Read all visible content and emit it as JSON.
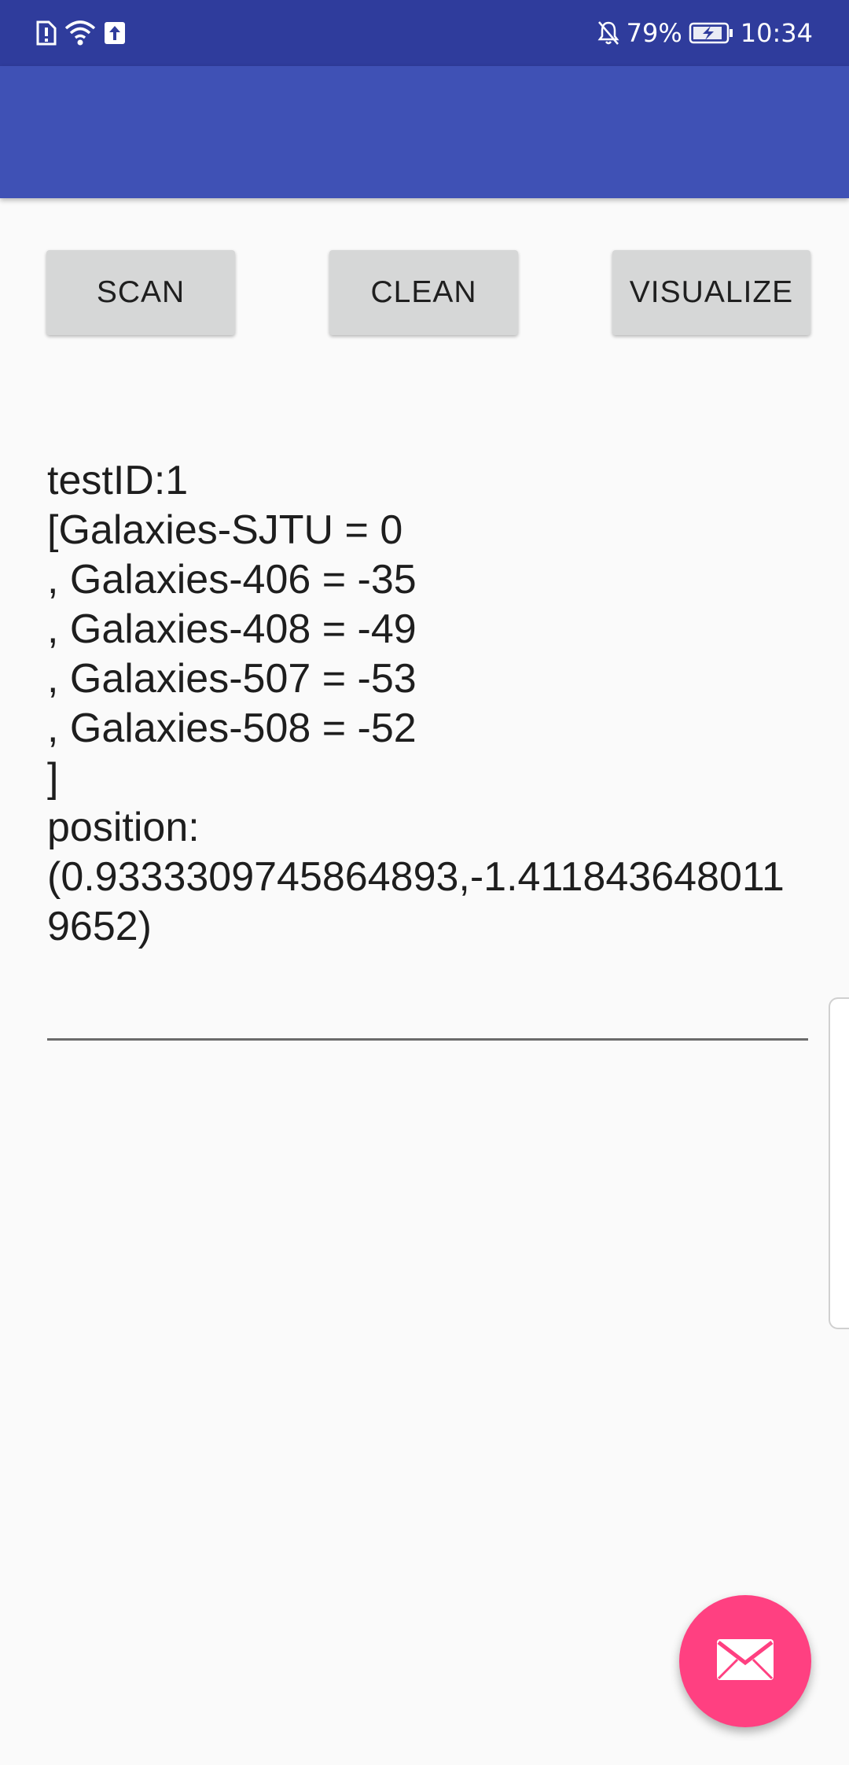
{
  "status_bar": {
    "battery_percent": "79%",
    "time": "10:34",
    "background": "#2f3c9c",
    "left_icons": [
      "sim-alert-icon",
      "wifi-icon",
      "upload-icon"
    ],
    "right_icons": [
      "notifications-off-icon",
      "battery-charging-icon"
    ]
  },
  "app_bar": {
    "background": "#3f51b5"
  },
  "buttons": {
    "scan": "SCAN",
    "clean": "CLEAN",
    "visualize": "VISUALIZE"
  },
  "result_text": "testID:1\n[Galaxies-SJTU = 0\n, Galaxies-406 = -35\n, Galaxies-408 = -49\n, Galaxies-507 = -53\n, Galaxies-508 = -52\n]\nposition:\n(0.9333309745864893,-1.4118436480119652)",
  "fab": {
    "icon": "email-icon",
    "color": "#ff4081"
  }
}
